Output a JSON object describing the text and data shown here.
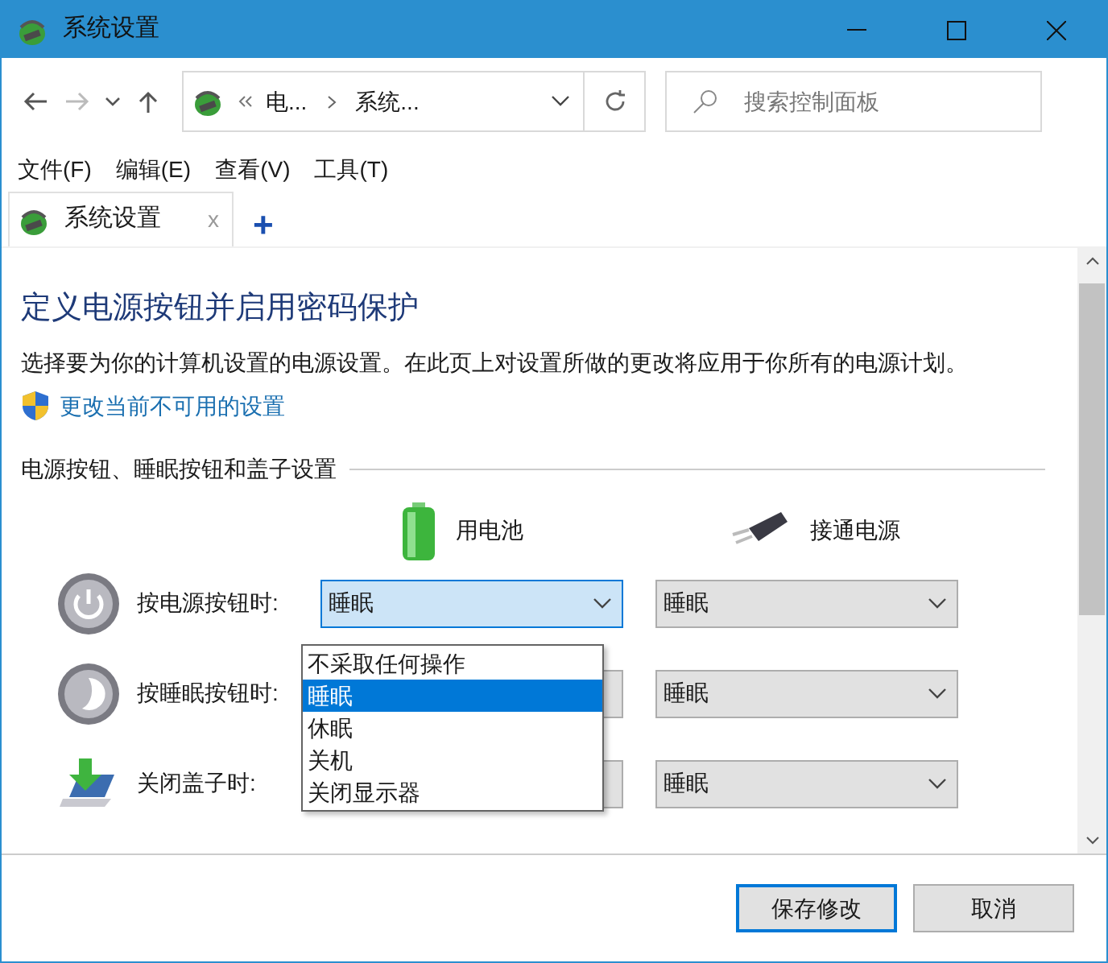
{
  "window": {
    "title": "系统设置"
  },
  "address": {
    "crumbs": [
      "电...",
      "系统..."
    ]
  },
  "search": {
    "placeholder": "搜索控制面板"
  },
  "menu": [
    "文件(F)",
    "编辑(E)",
    "查看(V)",
    "工具(T)"
  ],
  "tabs": [
    {
      "label": "系统设置",
      "selected": true
    }
  ],
  "tab_close": "x",
  "tab_add": "+",
  "heading": "定义电源按钮并启用密码保护",
  "description": "选择要为你的计算机设置的电源设置。在此页上对设置所做的更改将应用于你所有的电源计划。",
  "link": "更改当前不可用的设置",
  "section": "电源按钮、睡眠按钮和盖子设置",
  "columns": [
    {
      "kind": "battery",
      "label": "用电池"
    },
    {
      "kind": "plug",
      "label": "接通电源"
    }
  ],
  "rows": [
    {
      "kind": "power",
      "label": "按电源按钮时:",
      "battery": "睡眠",
      "plugged": "睡眠",
      "focused": true
    },
    {
      "kind": "sleep",
      "label": "按睡眠按钮时:",
      "plugged": "睡眠",
      "focused": false
    },
    {
      "kind": "lid",
      "label": "关闭盖子时:",
      "plugged": "睡眠",
      "focused": false
    }
  ],
  "open_list": [
    {
      "label": "不采取任何操作",
      "selected": false
    },
    {
      "label": "睡眠",
      "selected": true
    },
    {
      "label": "休眠",
      "selected": false
    },
    {
      "label": "关机",
      "selected": false
    },
    {
      "label": "关闭显示器",
      "selected": false
    }
  ],
  "buttons": [
    {
      "label": "保存修改",
      "default": true
    },
    {
      "label": "取消",
      "default": false
    }
  ]
}
